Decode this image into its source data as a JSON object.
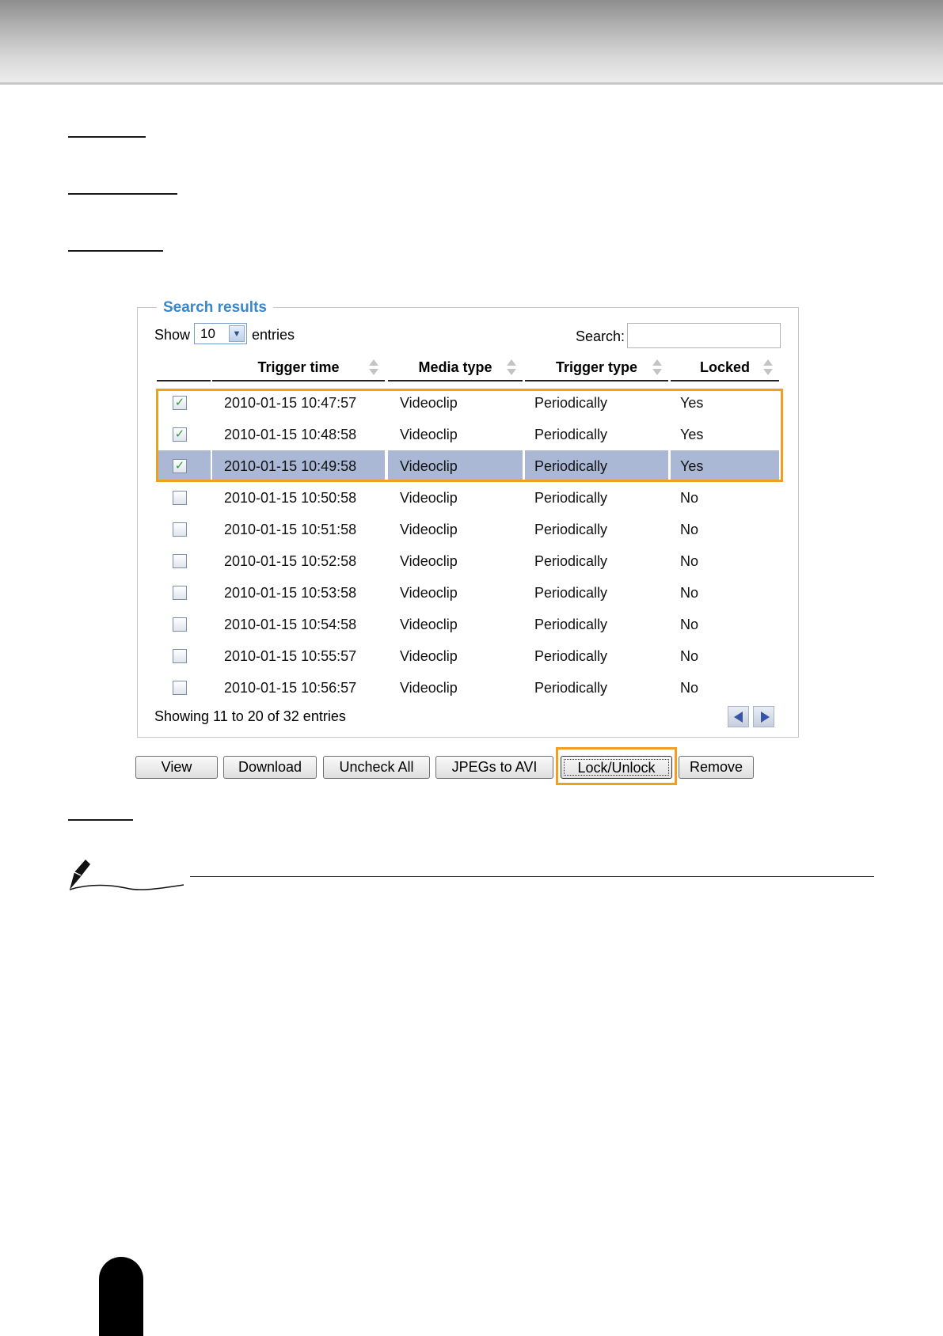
{
  "search_results": {
    "legend": "Search results",
    "show_label": "Show",
    "page_size": "10",
    "entries_label": "entries",
    "search_label": "Search:",
    "search_value": "",
    "columns": [
      "Trigger time",
      "Media type",
      "Trigger type",
      "Locked"
    ],
    "rows": [
      {
        "checked": true,
        "trigger_time": "2010-01-15 10:47:57",
        "media_type": "Videoclip",
        "trigger_type": "Periodically",
        "locked": "Yes"
      },
      {
        "checked": true,
        "trigger_time": "2010-01-15 10:48:58",
        "media_type": "Videoclip",
        "trigger_type": "Periodically",
        "locked": "Yes"
      },
      {
        "checked": true,
        "trigger_time": "2010-01-15 10:49:58",
        "media_type": "Videoclip",
        "trigger_type": "Periodically",
        "locked": "Yes",
        "selected": true
      },
      {
        "checked": false,
        "trigger_time": "2010-01-15 10:50:58",
        "media_type": "Videoclip",
        "trigger_type": "Periodically",
        "locked": "No"
      },
      {
        "checked": false,
        "trigger_time": "2010-01-15 10:51:58",
        "media_type": "Videoclip",
        "trigger_type": "Periodically",
        "locked": "No"
      },
      {
        "checked": false,
        "trigger_time": "2010-01-15 10:52:58",
        "media_type": "Videoclip",
        "trigger_type": "Periodically",
        "locked": "No"
      },
      {
        "checked": false,
        "trigger_time": "2010-01-15 10:53:58",
        "media_type": "Videoclip",
        "trigger_type": "Periodically",
        "locked": "No"
      },
      {
        "checked": false,
        "trigger_time": "2010-01-15 10:54:58",
        "media_type": "Videoclip",
        "trigger_type": "Periodically",
        "locked": "No"
      },
      {
        "checked": false,
        "trigger_time": "2010-01-15 10:55:57",
        "media_type": "Videoclip",
        "trigger_type": "Periodically",
        "locked": "No"
      },
      {
        "checked": false,
        "trigger_time": "2010-01-15 10:56:57",
        "media_type": "Videoclip",
        "trigger_type": "Periodically",
        "locked": "No"
      }
    ],
    "showing_info": "Showing 11 to 20 of 32 entries"
  },
  "buttons": {
    "view": "View",
    "download": "Download",
    "uncheck_all": "Uncheck All",
    "jpegs_to_avi": "JPEGs to AVI",
    "lock_unlock": "Lock/Unlock",
    "remove": "Remove"
  },
  "colors": {
    "legend": "#3a86c8",
    "highlight": "#f0a020",
    "selected_row": "#aab8d6"
  },
  "icons": {
    "note": "fountain-pen-icon",
    "prev": "triangle-left-icon",
    "next": "triangle-right-icon",
    "check": "checkmark-icon"
  }
}
